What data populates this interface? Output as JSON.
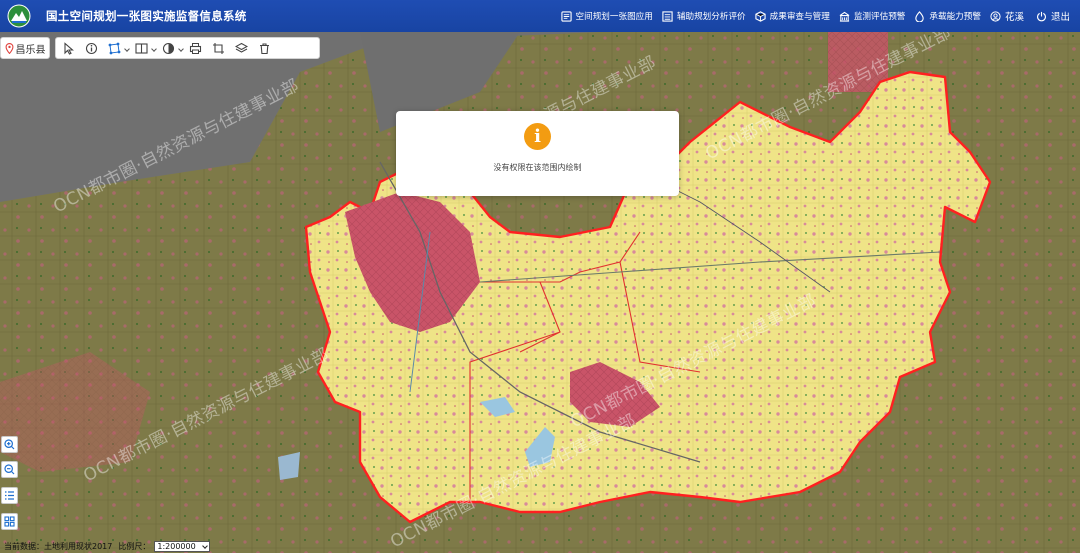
{
  "header": {
    "title": "国土空间规划一张图实施监督信息系统",
    "nav": [
      {
        "label": "空间规划一张图应用",
        "icon": "map-book-icon"
      },
      {
        "label": "辅助规划分析评价",
        "icon": "list-icon"
      },
      {
        "label": "成果审查与管理",
        "icon": "cube-icon"
      },
      {
        "label": "监测评估预警",
        "icon": "building-icon"
      },
      {
        "label": "承载能力预警",
        "icon": "drop-icon"
      }
    ],
    "user": "花溪",
    "logout": "退出"
  },
  "region": "昌乐县",
  "watermark": "OCN都市圈·自然资源与住建事业部",
  "dialog": {
    "message": "没有权限在该范围内绘制",
    "icon": "info-icon"
  },
  "status": {
    "current_data_label": "当前数据：",
    "current_data_value": "土地利用现状2017",
    "scale_label": "比例尺：",
    "scale_value": "1:200000"
  },
  "colors": {
    "header": "#1f4db3",
    "county_fill": "#f0e68c",
    "urban_fill": "#cc5566",
    "boundary": "#ff2020",
    "outer_land": "#7e7a48",
    "dialog_icon": "#f39c12"
  }
}
